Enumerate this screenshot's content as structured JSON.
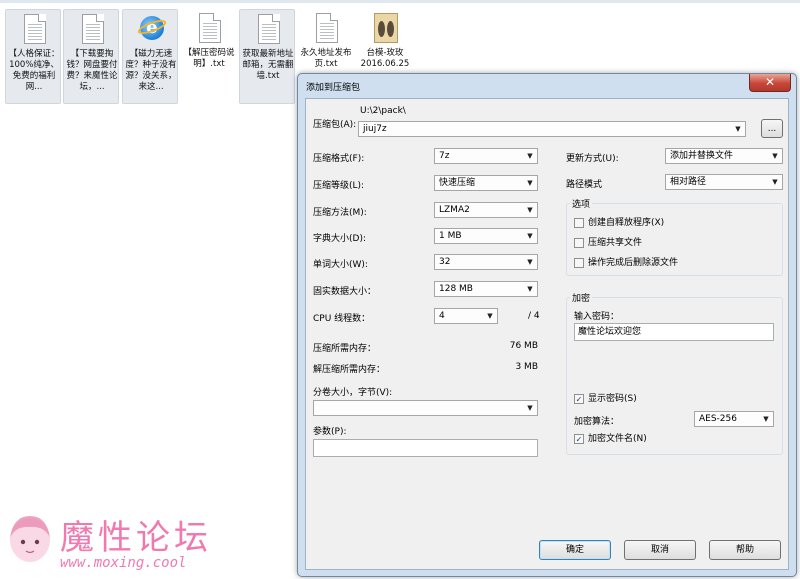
{
  "desktop": {
    "files": [
      {
        "name": "【人格保证：100%纯净、免费的福利网...",
        "type": "txt",
        "selected": true
      },
      {
        "name": "【下载要掏钱？网盘要付费？来魔性论坛，...",
        "type": "txt",
        "selected": true
      },
      {
        "name": "【磁力无速度？种子没有源？没关系，来这...",
        "type": "ie",
        "selected": true
      },
      {
        "name": "【解压密码说明】.txt",
        "type": "txt",
        "selected": false
      },
      {
        "name": "获取最新地址邮箱，无需翻墙.txt",
        "type": "txt",
        "selected": true
      },
      {
        "name": "永久地址发布页.txt",
        "type": "txt",
        "selected": false
      },
      {
        "name": "台模-玫玫2016.06.25",
        "type": "folder",
        "selected": false
      }
    ]
  },
  "dialog": {
    "title": "添加到压缩包",
    "close": "✕",
    "archive_label": "压缩包(A):",
    "archive_path": "U:\\2\\pack\\",
    "archive_name": "jiuj7z",
    "browse": "...",
    "format_label": "压缩格式(F):",
    "format_value": "7z",
    "level_label": "压缩等级(L):",
    "level_value": "快速压缩",
    "method_label": "压缩方法(M):",
    "method_value": "LZMA2",
    "dict_label": "字典大小(D):",
    "dict_value": "1 MB",
    "word_label": "单词大小(W):",
    "word_value": "32",
    "solid_label": "固实数据大小：",
    "solid_value": "128 MB",
    "cpu_label": "CPU 线程数：",
    "cpu_value": "4",
    "cpu_total": "/ 4",
    "mem_comp_label": "压缩所需内存：",
    "mem_comp_value": "76 MB",
    "mem_decomp_label": "解压缩所需内存：",
    "mem_decomp_value": "3 MB",
    "split_label": "分卷大小，字节(V):",
    "split_value": "",
    "params_label": "参数(P):",
    "params_value": "",
    "update_label": "更新方式(U):",
    "update_value": "添加并替换文件",
    "path_label": "路径模式",
    "path_value": "相对路径",
    "options_title": "选项",
    "opt_sfx": "创建自释放程序(X)",
    "opt_shared": "压缩共享文件",
    "opt_delete": "操作完成后删除源文件",
    "enc_title": "加密",
    "pwd_label": "输入密码：",
    "pwd_value": "魔性论坛欢迎您",
    "show_pwd": "显示密码(S)",
    "enc_method_label": "加密算法：",
    "enc_method_value": "AES-256",
    "enc_names": "加密文件名(N)",
    "ok": "确定",
    "cancel": "取消",
    "help": "帮助",
    "checked": "✓"
  },
  "watermark": {
    "text": "魔性论坛",
    "url": "www.moxing.cool"
  }
}
